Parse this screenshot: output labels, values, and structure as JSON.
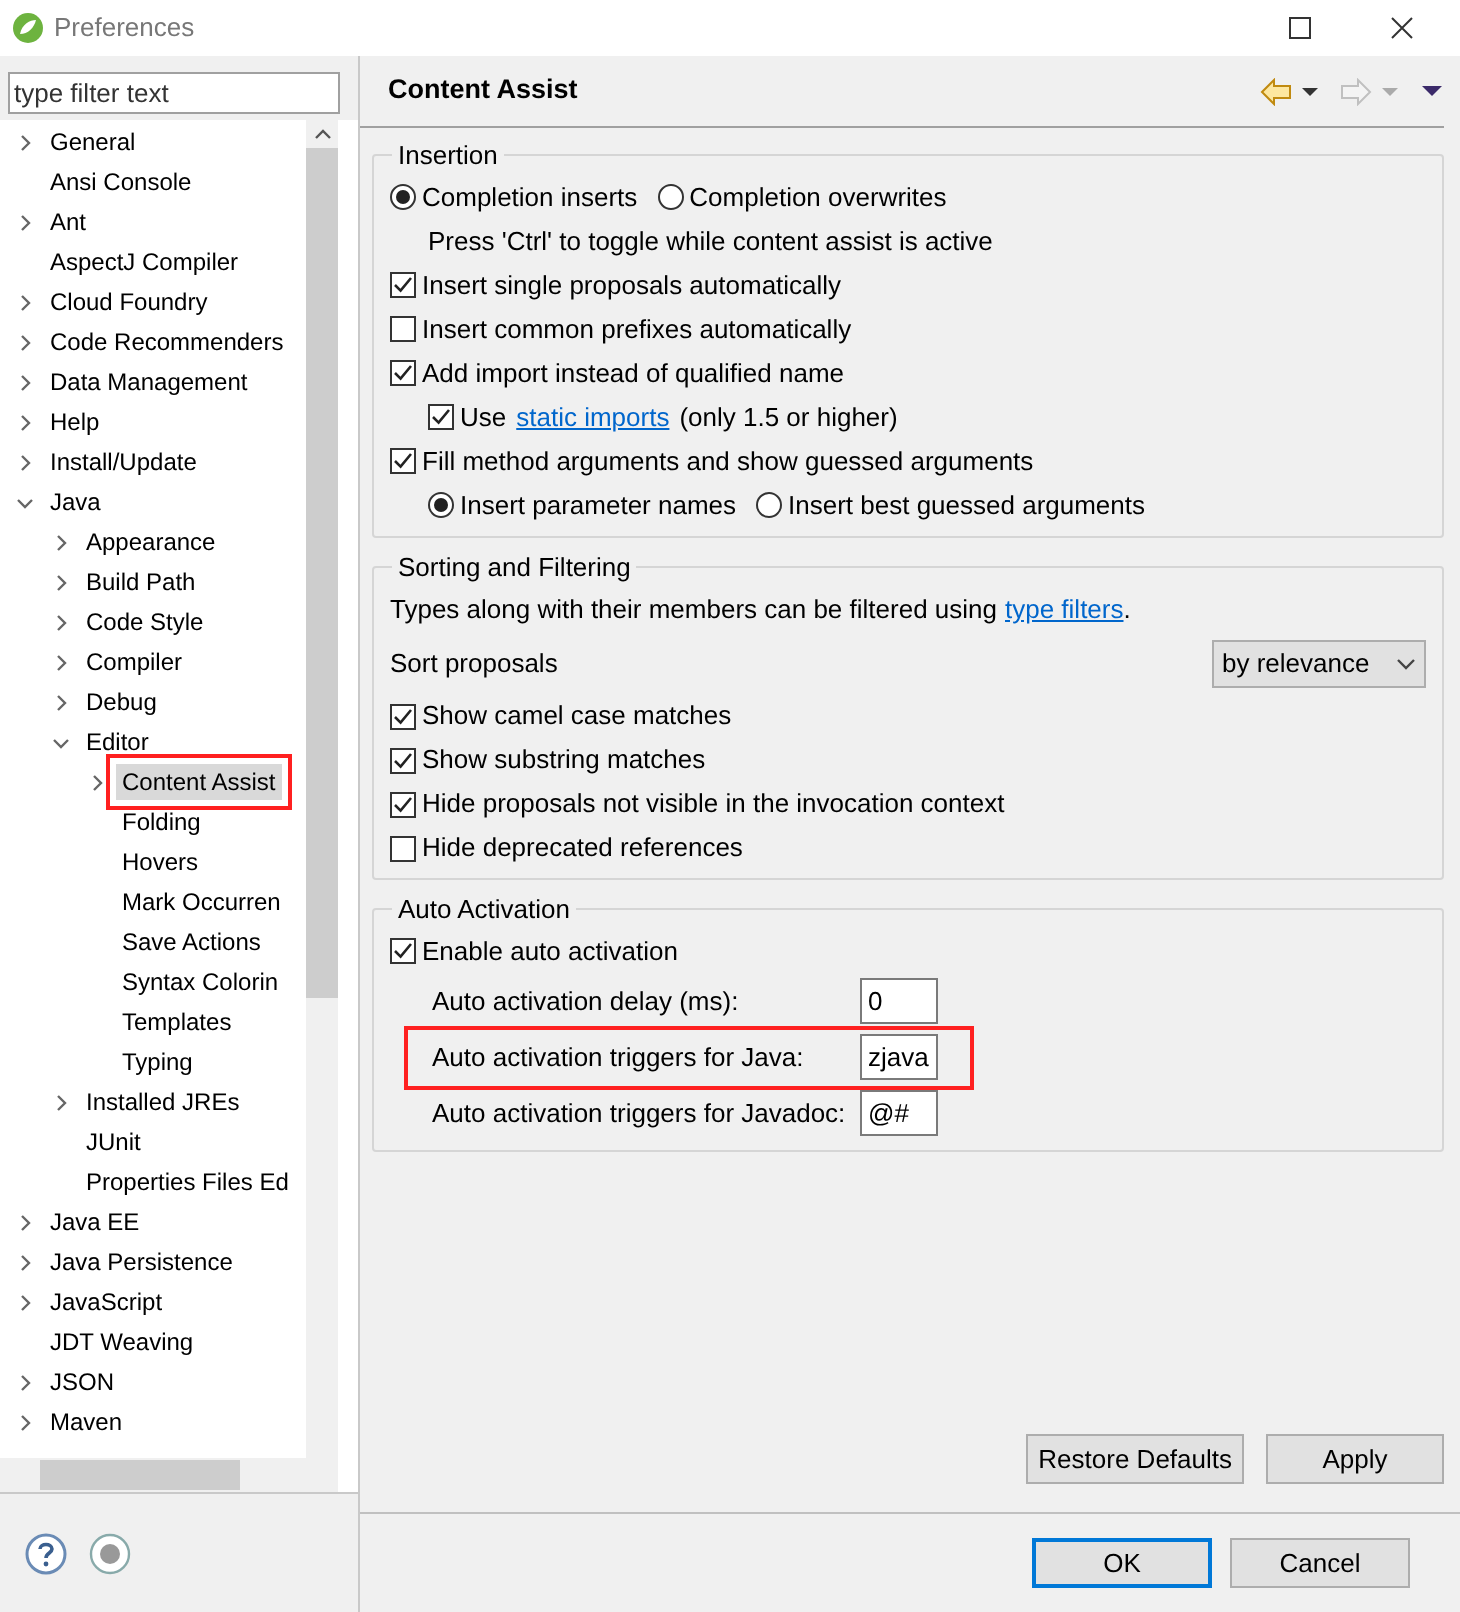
{
  "window": {
    "title": "Preferences"
  },
  "filter": {
    "placeholder": "type filter text"
  },
  "tree": [
    {
      "label": "General",
      "kind": "collapsed",
      "selected": false,
      "highlighted": false
    },
    {
      "label": "Ansi Console",
      "kind": "leaf",
      "selected": false,
      "highlighted": false
    },
    {
      "label": "Ant",
      "kind": "collapsed",
      "selected": false,
      "highlighted": false
    },
    {
      "label": "AspectJ Compiler",
      "kind": "leaf",
      "selected": false,
      "highlighted": false
    },
    {
      "label": "Cloud Foundry",
      "kind": "collapsed",
      "selected": false,
      "highlighted": false
    },
    {
      "label": "Code Recommenders",
      "kind": "collapsed",
      "selected": false,
      "highlighted": false
    },
    {
      "label": "Data Management",
      "kind": "collapsed",
      "selected": false,
      "highlighted": false
    },
    {
      "label": "Help",
      "kind": "collapsed",
      "selected": false,
      "highlighted": false
    },
    {
      "label": "Install/Update",
      "kind": "collapsed",
      "selected": false,
      "highlighted": false
    },
    {
      "label": "Java",
      "kind": "expanded",
      "selected": false,
      "highlighted": false,
      "children": [
        {
          "label": "Appearance",
          "kind": "collapsed",
          "selected": false,
          "highlighted": false
        },
        {
          "label": "Build Path",
          "kind": "collapsed",
          "selected": false,
          "highlighted": false
        },
        {
          "label": "Code Style",
          "kind": "collapsed",
          "selected": false,
          "highlighted": false
        },
        {
          "label": "Compiler",
          "kind": "collapsed",
          "selected": false,
          "highlighted": false
        },
        {
          "label": "Debug",
          "kind": "collapsed",
          "selected": false,
          "highlighted": false
        },
        {
          "label": "Editor",
          "kind": "expanded",
          "selected": false,
          "highlighted": false,
          "children": [
            {
              "label": "Content Assist",
              "kind": "collapsed",
              "selected": true,
              "highlighted": true
            },
            {
              "label": "Folding",
              "kind": "leaf",
              "selected": false,
              "highlighted": false
            },
            {
              "label": "Hovers",
              "kind": "leaf",
              "selected": false,
              "highlighted": false
            },
            {
              "label": "Mark Occurren",
              "kind": "leaf",
              "selected": false,
              "highlighted": false
            },
            {
              "label": "Save Actions",
              "kind": "leaf",
              "selected": false,
              "highlighted": false
            },
            {
              "label": "Syntax Colorin",
              "kind": "leaf",
              "selected": false,
              "highlighted": false
            },
            {
              "label": "Templates",
              "kind": "leaf",
              "selected": false,
              "highlighted": false
            },
            {
              "label": "Typing",
              "kind": "leaf",
              "selected": false,
              "highlighted": false
            }
          ]
        },
        {
          "label": "Installed JREs",
          "kind": "collapsed",
          "selected": false,
          "highlighted": false
        },
        {
          "label": "JUnit",
          "kind": "leaf",
          "selected": false,
          "highlighted": false
        },
        {
          "label": "Properties Files Ed",
          "kind": "leaf",
          "selected": false,
          "highlighted": false
        }
      ]
    },
    {
      "label": "Java EE",
      "kind": "collapsed",
      "selected": false,
      "highlighted": false
    },
    {
      "label": "Java Persistence",
      "kind": "collapsed",
      "selected": false,
      "highlighted": false
    },
    {
      "label": "JavaScript",
      "kind": "collapsed",
      "selected": false,
      "highlighted": false
    },
    {
      "label": "JDT Weaving",
      "kind": "leaf",
      "selected": false,
      "highlighted": false
    },
    {
      "label": "JSON",
      "kind": "collapsed",
      "selected": false,
      "highlighted": false
    },
    {
      "label": "Maven",
      "kind": "collapsed",
      "selected": false,
      "highlighted": false
    }
  ],
  "page": {
    "title": "Content Assist"
  },
  "groups": [
    {
      "title": "Insertion",
      "rows": [
        {
          "kind": "radios",
          "options": [
            {
              "label": "Completion inserts",
              "selected": true
            },
            {
              "label": "Completion overwrites",
              "selected": false
            }
          ],
          "note": "Press 'Ctrl' to toggle while content assist is active"
        },
        {
          "kind": "checkbox",
          "label": "Insert single proposals automatically",
          "checked": true
        },
        {
          "kind": "checkbox",
          "label": "Insert common prefixes automatically",
          "checked": false
        },
        {
          "kind": "checkbox",
          "label": "Add import instead of qualified name",
          "checked": true,
          "children": [
            {
              "kind": "checkbox",
              "label": "Use",
              "link": "static imports",
              "suffix": "(only 1.5 or higher)",
              "checked": true
            }
          ]
        },
        {
          "kind": "checkbox",
          "label": "Fill method arguments and show guessed arguments",
          "checked": true,
          "children": [
            {
              "kind": "radios",
              "options": [
                {
                  "label": "Insert parameter names",
                  "selected": true
                },
                {
                  "label": "Insert best guessed arguments",
                  "selected": false
                }
              ]
            }
          ]
        }
      ]
    },
    {
      "title": "Sorting and Filtering",
      "rows": [
        {
          "kind": "text",
          "label": "Types along with their members can be filtered using",
          "link": "type filters",
          "suffix": "."
        },
        {
          "kind": "select",
          "label": "Sort proposals",
          "value": "by relevance"
        },
        {
          "kind": "checkbox",
          "label": "Show camel case matches",
          "checked": true
        },
        {
          "kind": "checkbox",
          "label": "Show substring matches",
          "checked": true
        },
        {
          "kind": "checkbox",
          "label": "Hide proposals not visible in the invocation context",
          "checked": true
        },
        {
          "kind": "checkbox",
          "label": "Hide deprecated references",
          "checked": false
        }
      ]
    },
    {
      "title": "Auto Activation",
      "rows": [
        {
          "kind": "checkbox",
          "label": "Enable auto activation",
          "checked": true,
          "children": [
            {
              "kind": "field",
              "label": "Auto activation delay (ms):",
              "value": "0",
              "highlighted": false
            },
            {
              "kind": "field",
              "label": "Auto activation triggers for Java:",
              "value": "zjava",
              "highlighted": true
            },
            {
              "kind": "field",
              "label": "Auto activation triggers for Javadoc:",
              "value": "@#",
              "highlighted": false
            }
          ]
        }
      ]
    }
  ],
  "page_buttons": [
    "Restore Defaults",
    "Apply"
  ],
  "dialog_buttons": [
    {
      "label": "OK",
      "default": true
    },
    {
      "label": "Cancel",
      "default": false
    }
  ]
}
